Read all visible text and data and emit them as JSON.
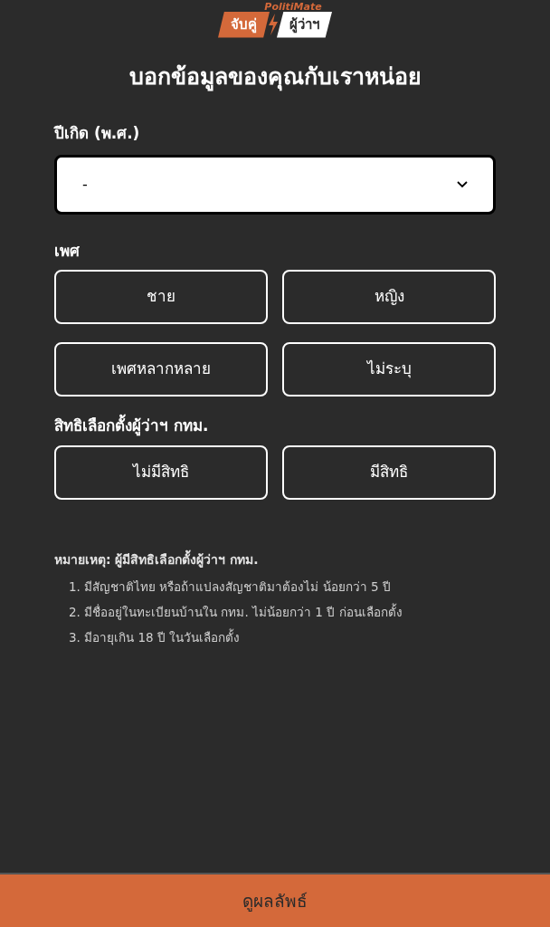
{
  "logo": {
    "brand": "PolitiMate",
    "left": "จับคู่",
    "right": "ผู้ว่าฯ"
  },
  "title": "บอกข้อมูลของคุณกับเราหน่อย",
  "birth_year": {
    "label": "ปีเกิด (พ.ศ.)",
    "value": "-"
  },
  "gender": {
    "label": "เพศ",
    "options": [
      {
        "label": "ชาย",
        "selected": false
      },
      {
        "label": "หญิง",
        "selected": false
      },
      {
        "label": "เพศหลากหลาย",
        "selected": false
      },
      {
        "label": "ไม่ระบุ",
        "selected": false
      }
    ]
  },
  "voting_right": {
    "label": "สิทธิเลือกตั้งผู้ว่าฯ กทม.",
    "options": [
      {
        "label": "ไม่มีสิทธิ",
        "selected": false
      },
      {
        "label": "มีสิทธิ",
        "selected": false
      }
    ]
  },
  "note": {
    "title": "หมายเหตุ: ผู้มีสิทธิเลือกตั้งผู้ว่าฯ กทม.",
    "items": [
      "1. มีสัญชาติไทย หรือถ้าแปลงสัญชาติมาต้องไม่ น้อยกว่า 5 ปี",
      "2. มีชื่ออยู่ในทะเบียนบ้านใน กทม. ไม่น้อยกว่า 1 ปี ก่อนเลือกตั้ง",
      "3. มีอายุเกิน 18 ปี ในวันเลือกตั้ง"
    ]
  },
  "submit": "ดูผลลัพธ์"
}
